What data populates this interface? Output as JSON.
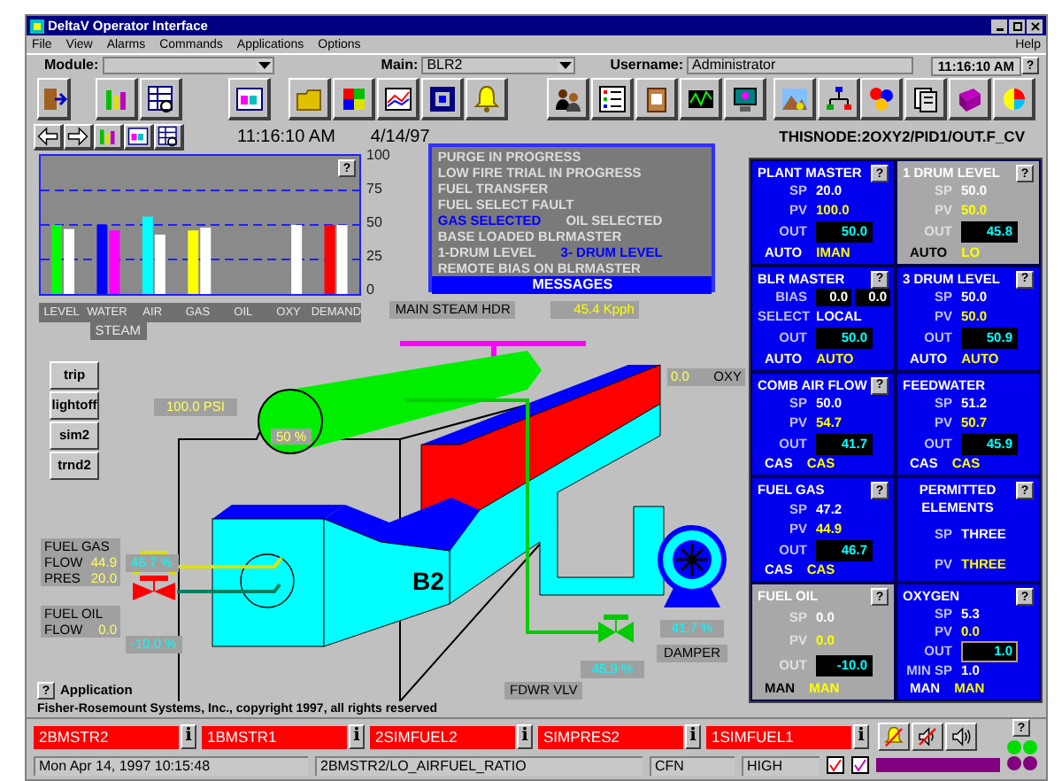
{
  "window": {
    "title": "DeltaV Operator Interface"
  },
  "menu": [
    "File",
    "View",
    "Alarms",
    "Commands",
    "Applications",
    "Options"
  ],
  "help_menu": "Help",
  "toolbar": {
    "module_label": "Module:",
    "main_label": "Main:",
    "main_value": "BLR2",
    "username_label": "Username:",
    "username_value": "Administrator",
    "clock": "11:16:10 AM",
    "help": "?"
  },
  "nav": {
    "time": "11:16:10 AM",
    "date": "4/14/97",
    "path": "THISNODE:2OXY2/PID1/OUT.F_CV"
  },
  "chart_panel": {
    "help": "?",
    "steam_label": "STEAM",
    "chart_data": {
      "type": "bar",
      "grid": true,
      "categories": [
        "LEVEL",
        "WATER",
        "AIR",
        "GAS",
        "OIL",
        "OXY",
        "DEMAND"
      ],
      "ylim": [
        0,
        100
      ],
      "yticks": [
        0,
        25,
        50,
        75,
        100
      ],
      "series": [
        {
          "colors": [
            "#00ff00",
            "#0000ff",
            "#00ffff",
            "#ffff00",
            null,
            null,
            "#ff0000"
          ],
          "values": [
            50,
            50,
            56,
            46,
            null,
            null,
            50
          ]
        },
        {
          "colors": [
            "#ffffff",
            "#ff00ff",
            "#ffffff",
            "#ffffff",
            null,
            "#ffffff",
            "#ffffff"
          ],
          "values": [
            47,
            46,
            43,
            48,
            null,
            50,
            50
          ]
        }
      ]
    }
  },
  "messages": {
    "title": "MESSAGES",
    "rows": [
      [
        {
          "text": "PURGE IN PROGRESS",
          "active": false
        }
      ],
      [
        {
          "text": "LOW FIRE TRIAL IN PROGRESS",
          "active": false
        }
      ],
      [
        {
          "text": "FUEL TRANSFER",
          "active": false
        }
      ],
      [
        {
          "text": "FUEL SELECT FAULT",
          "active": false
        }
      ],
      [
        {
          "text": "GAS SELECTED",
          "active": true
        },
        {
          "text": "OIL SELECTED",
          "active": false
        }
      ],
      [
        {
          "text": "BASE LOADED BLRMASTER",
          "active": false
        }
      ],
      [
        {
          "text": "1-DRUM LEVEL",
          "active": false
        },
        {
          "text": "3- DRUM LEVEL",
          "active": true
        }
      ],
      [
        {
          "text": "REMOTE BIAS ON BLRMASTER",
          "active": false
        }
      ]
    ]
  },
  "diagram": {
    "header_label": "MAIN STEAM HDR",
    "steam_flow": "45.4 Kpph",
    "drum_pressure": "100.0 PSI",
    "drum_level": "50 %",
    "oxy_value": "0.0",
    "oxy_label": "OXY",
    "boiler_label": "B2",
    "buttons": [
      "trip",
      "lightoff",
      "sim2",
      "trnd2"
    ],
    "fuel_gas": {
      "title": "FUEL GAS",
      "flow_label": "FLOW",
      "flow": "44.9",
      "pres_label": "PRES",
      "pres": "20.0",
      "valve": "46.7 %"
    },
    "fuel_oil": {
      "title": "FUEL OIL",
      "flow_label": "FLOW",
      "flow": "0.0",
      "valve": "-10.0 %"
    },
    "damper_value": "41.7 %",
    "damper_label": "DAMPER",
    "fdwr_value": "45.9 %",
    "fdwr_label": "FDWR VLV",
    "app_help": "?",
    "app_label": "Application"
  },
  "copyright": "Fisher-Rosemount Systems, Inc., copyright 1997, all rights reserved",
  "faceplates": [
    {
      "title": "PLANT MASTER",
      "kind": "loop",
      "active": true,
      "help": "?",
      "rows": [
        {
          "kind": "sp",
          "label": "SP",
          "value": "20.0"
        },
        {
          "kind": "pv",
          "label": "PV",
          "value": "100.0"
        },
        {
          "kind": "out",
          "label": "OUT",
          "value": "50.0",
          "focused": false
        }
      ],
      "modes": [
        "AUTO",
        "IMAN"
      ]
    },
    {
      "title": "1 DRUM LEVEL",
      "kind": "loop",
      "active": false,
      "help": "?",
      "rows": [
        {
          "kind": "sp",
          "label": "SP",
          "value": "50.0"
        },
        {
          "kind": "pv",
          "label": "PV",
          "value": "50.0"
        },
        {
          "kind": "out",
          "label": "OUT",
          "value": "45.8",
          "focused": false
        }
      ],
      "modes": [
        "AUTO",
        "LO"
      ]
    },
    {
      "title": "BLR MASTER",
      "kind": "loop",
      "active": true,
      "help": "?",
      "rows": [
        {
          "kind": "bias",
          "label": "BIAS",
          "values": [
            "0.0",
            "0.0"
          ]
        },
        {
          "kind": "select",
          "label": "SELECT",
          "value": "LOCAL"
        },
        {
          "kind": "out",
          "label": "OUT",
          "value": "50.0",
          "focused": false
        }
      ],
      "modes": [
        "AUTO",
        "AUTO"
      ]
    },
    {
      "title": "3 DRUM LEVEL",
      "kind": "loop",
      "active": true,
      "help": "?",
      "rows": [
        {
          "kind": "sp",
          "label": "SP",
          "value": "50.0"
        },
        {
          "kind": "pv",
          "label": "PV",
          "value": "50.0"
        },
        {
          "kind": "out",
          "label": "OUT",
          "value": "50.9",
          "focused": false
        }
      ],
      "modes": [
        "AUTO",
        "AUTO"
      ]
    },
    {
      "title": "COMB AIR FLOW",
      "kind": "loop",
      "active": true,
      "help": "?",
      "rows": [
        {
          "kind": "sp",
          "label": "SP",
          "value": "50.0"
        },
        {
          "kind": "pv",
          "label": "PV",
          "value": "54.7"
        },
        {
          "kind": "out",
          "label": "OUT",
          "value": "41.7",
          "focused": false
        }
      ],
      "modes": [
        "CAS",
        "CAS"
      ]
    },
    {
      "title": "FEEDWATER",
      "kind": "loop",
      "active": true,
      "rows": [
        {
          "kind": "sp",
          "label": "SP",
          "value": "51.2"
        },
        {
          "kind": "pv",
          "label": "PV",
          "value": "50.7"
        },
        {
          "kind": "out",
          "label": "OUT",
          "value": "45.9",
          "focused": false
        }
      ],
      "modes": [
        "CAS",
        "CAS"
      ]
    },
    {
      "title": "FUEL GAS",
      "kind": "loop",
      "active": true,
      "help": "?",
      "rows": [
        {
          "kind": "sp",
          "label": "SP",
          "value": "47.2"
        },
        {
          "kind": "pv",
          "label": "PV",
          "value": "44.9"
        },
        {
          "kind": "out",
          "label": "OUT",
          "value": "46.7",
          "focused": false
        }
      ],
      "modes": [
        "CAS",
        "CAS"
      ]
    },
    {
      "title": "PERMITTED ELEMENTS",
      "kind": "selector",
      "active": true,
      "help": "?",
      "rows": [
        {
          "kind": "sp",
          "label": "SP",
          "value": "THREE"
        },
        {
          "kind": "pv",
          "label": "PV",
          "value": "THREE"
        }
      ]
    },
    {
      "title": "FUEL OIL",
      "kind": "loop",
      "active": false,
      "help": "?",
      "rows": [
        {
          "kind": "sp",
          "label": "SP",
          "value": "0.0"
        },
        {
          "kind": "pv",
          "label": "PV",
          "value": "0.0"
        },
        {
          "kind": "out",
          "label": "OUT",
          "value": "-10.0",
          "focused": false
        }
      ],
      "modes": [
        "MAN",
        "MAN"
      ]
    },
    {
      "title": "OXYGEN",
      "kind": "loop",
      "active": true,
      "help": "?",
      "rows": [
        {
          "kind": "sp",
          "label": "SP",
          "value": "5.3"
        },
        {
          "kind": "pv",
          "label": "PV",
          "value": "0.0"
        },
        {
          "kind": "out",
          "label": "OUT",
          "value": "1.0",
          "focused": true
        },
        {
          "kind": "sp",
          "label": "MIN SP",
          "value": "1.0"
        }
      ],
      "modes": [
        "MAN",
        "MAN"
      ]
    }
  ],
  "alarms": [
    {
      "tag": "2BMSTR2",
      "info": "i"
    },
    {
      "tag": "1BMSTR1",
      "info": "i"
    },
    {
      "tag": "2SIMFUEL2",
      "info": "i"
    },
    {
      "tag": "SIMPRES2",
      "info": "i"
    },
    {
      "tag": "1SIMFUEL1",
      "info": "i"
    }
  ],
  "alarm_help": "?",
  "status": {
    "datetime": "Mon Apr 14, 1997 10:15:48",
    "alarm_text": "2BMSTR2/LO_AIRFUEL_RATIO",
    "type": "CFN",
    "priority": "HIGH"
  }
}
